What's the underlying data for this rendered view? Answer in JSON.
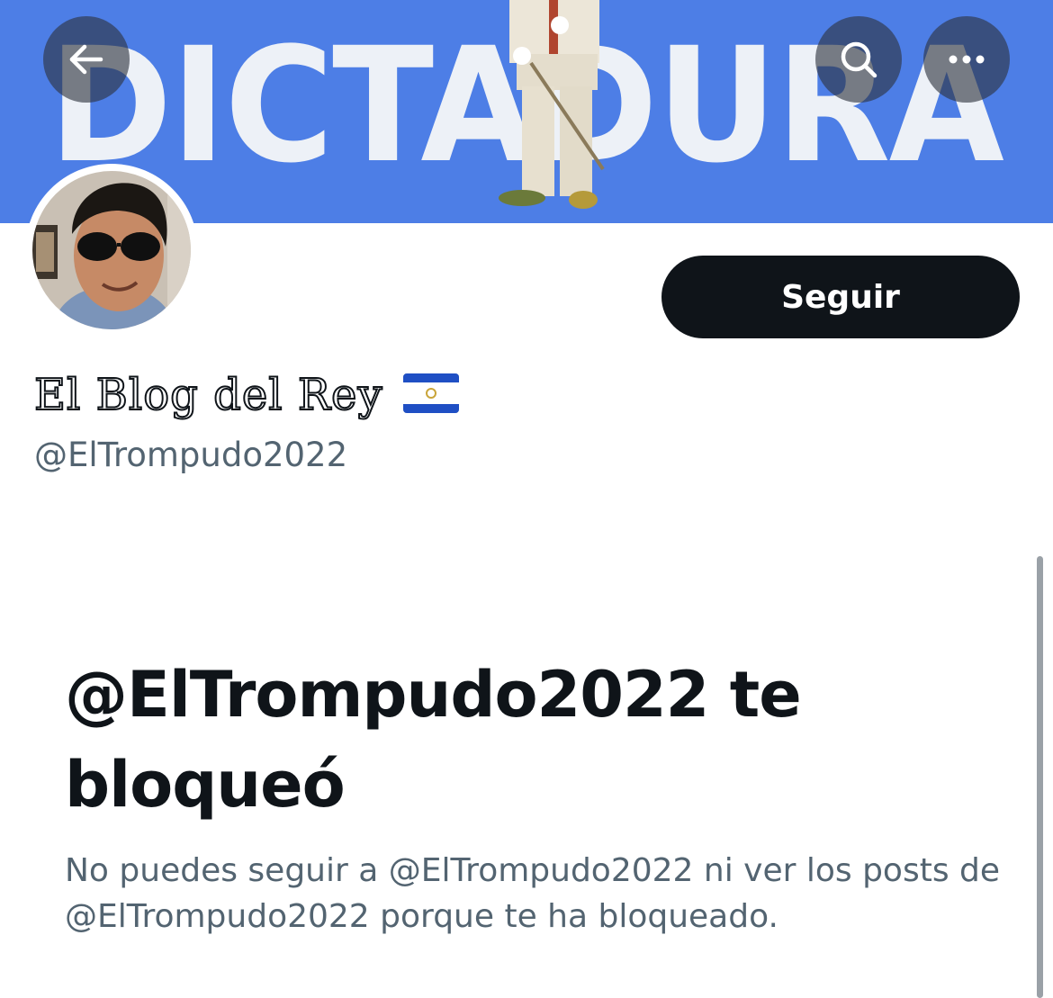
{
  "banner": {
    "text": "DICTADURA",
    "color": "#4d7ee6"
  },
  "nav": {
    "back_icon": "arrow-left-icon",
    "search_icon": "search-icon",
    "more_icon": "ellipsis-icon"
  },
  "profile": {
    "display_name": "El Blog del Rey",
    "flag_icon": "el-salvador-flag-icon",
    "handle": "@ElTrompudo2022",
    "follow_label": "Seguir"
  },
  "blocked": {
    "title": "@ElTrompudo2022 te bloqueó",
    "description": "No puedes seguir a @ElTrompudo2022 ni ver los posts de @ElTrompudo2022 porque te ha bloqueado."
  },
  "colors": {
    "text_primary": "#0f1419",
    "text_secondary": "#536471",
    "button_bg": "#0f1419",
    "banner_bg": "#4d7ee6"
  }
}
